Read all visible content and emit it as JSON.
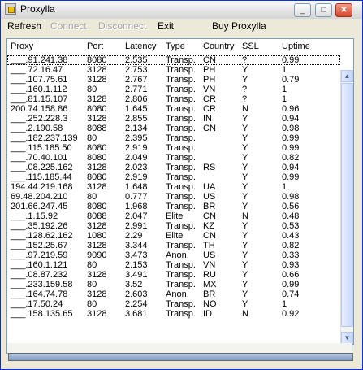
{
  "window": {
    "title": "Proxylla"
  },
  "window_controls": {
    "minimize": "_",
    "maximize": "□",
    "close": "✕"
  },
  "menu": {
    "refresh": "Refresh",
    "connect": "Connect",
    "disconnect": "Disconnect",
    "exit": "Exit",
    "buy": "Buy Proxylla"
  },
  "columns": [
    "Proxy",
    "Port",
    "Latency",
    "Type",
    "Country",
    "SSL",
    "Uptime"
  ],
  "rows": [
    [
      "___.91.241.38",
      "8080",
      "2.535",
      "Transp.",
      "CN",
      "?",
      "0.99"
    ],
    [
      "___.72.16.47",
      "3128",
      "2.753",
      "Transp.",
      "PH",
      "Y",
      "1"
    ],
    [
      "___.107.75.61",
      "3128",
      "2.767",
      "Transp.",
      "PH",
      "Y",
      "0.79"
    ],
    [
      "___.160.1.112",
      "80",
      "2.771",
      "Transp.",
      "VN",
      "?",
      "1"
    ],
    [
      "___.81.15.107",
      "3128",
      "2.806",
      "Transp.",
      "CR",
      "?",
      "1"
    ],
    [
      "200.74.158.86",
      "8080",
      "1.645",
      "Transp.",
      "CR",
      "N",
      "0.96"
    ],
    [
      "___.252.228.3",
      "3128",
      "2.855",
      "Transp.",
      "IN",
      "Y",
      "0.94"
    ],
    [
      "___.2.190.58",
      "8088",
      "2.134",
      "Transp.",
      "CN",
      "Y",
      "0.98"
    ],
    [
      "___.182.237.139",
      "80",
      "2.395",
      "Transp.",
      "",
      "Y",
      "0.99"
    ],
    [
      "___.115.185.50",
      "8080",
      "2.919",
      "Transp.",
      "",
      "Y",
      "0.99"
    ],
    [
      "___.70.40.101",
      "8080",
      "2.049",
      "Transp.",
      "",
      "Y",
      "0.82"
    ],
    [
      "___.08.225.162",
      "3128",
      "2.023",
      "Transp.",
      "RS",
      "Y",
      "0.94"
    ],
    [
      "___.115.185.44",
      "8080",
      "2.919",
      "Transp.",
      "",
      "Y",
      "0.99"
    ],
    [
      "194.44.219.168",
      "3128",
      "1.648",
      "Transp.",
      "UA",
      "Y",
      "1"
    ],
    [
      "69.48.204.210",
      "80",
      "0.777",
      "Transp.",
      "US",
      "Y",
      "0.98"
    ],
    [
      "201.66.247.45",
      "8080",
      "1.968",
      "Transp.",
      "BR",
      "Y",
      "0.56"
    ],
    [
      "___.1.15.92",
      "8088",
      "2.047",
      "Elite",
      "CN",
      "N",
      "0.48"
    ],
    [
      "___.35.192.26",
      "3128",
      "2.991",
      "Transp.",
      "KZ",
      "Y",
      "0.53"
    ],
    [
      "___.128.62.162",
      "1080",
      "2.29",
      "Elite",
      "CN",
      "Y",
      "0.43"
    ],
    [
      "___.152.25.67",
      "3128",
      "3.344",
      "Transp.",
      "TH",
      "Y",
      "0.82"
    ],
    [
      "___.97.219.59",
      "9090",
      "3.473",
      "Anon.",
      "US",
      "Y",
      "0.33"
    ],
    [
      "___.160.1.121",
      "80",
      "2.153",
      "Transp.",
      "VN",
      "Y",
      "0.93"
    ],
    [
      "___.08.87.232",
      "3128",
      "3.491",
      "Transp.",
      "RU",
      "Y",
      "0.66"
    ],
    [
      "___.233.159.58",
      "80",
      "3.52",
      "Transp.",
      "MX",
      "Y",
      "0.99"
    ],
    [
      "___.164.74.78",
      "3128",
      "2.603",
      "Anon.",
      "BR",
      "Y",
      "0.74"
    ],
    [
      "___.17.50.24",
      "80",
      "2.254",
      "Transp.",
      "NO",
      "Y",
      "1"
    ],
    [
      "___.158.135.65",
      "3128",
      "3.681",
      "Transp.",
      "ID",
      "N",
      "0.92"
    ]
  ],
  "progress": {
    "value": 1.0
  }
}
